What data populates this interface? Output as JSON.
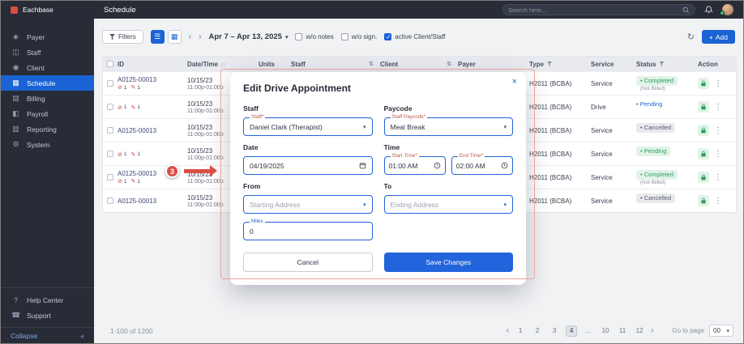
{
  "app": {
    "brand": "Eachbase",
    "title": "Schedule"
  },
  "topbar": {
    "search_placeholder": "Search here..."
  },
  "sidebar": {
    "items": [
      {
        "label": "Payer",
        "icon": "◈"
      },
      {
        "label": "Staff",
        "icon": "◫"
      },
      {
        "label": "Client",
        "icon": "◉"
      },
      {
        "label": "Schedule",
        "icon": "▦"
      },
      {
        "label": "Billing",
        "icon": "▤"
      },
      {
        "label": "Payroll",
        "icon": "◧"
      },
      {
        "label": "Reporting",
        "icon": "▥"
      },
      {
        "label": "System",
        "icon": "⚙"
      }
    ],
    "footer": [
      {
        "label": "Help Center",
        "icon": "?"
      },
      {
        "label": "Support",
        "icon": "☎"
      }
    ],
    "collapse": "Collapse",
    "collapse_icon": "«"
  },
  "toolbar": {
    "filters": "Filters",
    "date_range": "Apr 7 – Apr 13, 2025",
    "checkboxes": [
      {
        "label": "w/o notes",
        "checked": false
      },
      {
        "label": "w/o sign.",
        "checked": false
      },
      {
        "label": "active Client/Staff",
        "checked": true
      }
    ],
    "add": "Add",
    "add_plus": "+"
  },
  "table": {
    "columns": [
      {
        "label": "ID"
      },
      {
        "label": "Date/Time"
      },
      {
        "label": "Units"
      },
      {
        "label": "Staff"
      },
      {
        "label": "Client"
      },
      {
        "label": "Payer"
      },
      {
        "label": "Type"
      },
      {
        "label": "Service"
      },
      {
        "label": "Status"
      },
      {
        "label": "Action"
      }
    ],
    "rows": [
      {
        "id": "A0125-00013",
        "has_icons": true,
        "notes_count": "1",
        "sign_count": "1",
        "date": "10/15/23",
        "time": "11:00p-01:00p",
        "type": "H2011 (BCBA)",
        "service": "Service",
        "status": "Completed",
        "status_note": "(Not Billed)",
        "status_kind": "completed"
      },
      {
        "id": "",
        "has_icons": true,
        "notes_count": "1",
        "sign_count": "1",
        "date": "10/15/23",
        "time": "11:00p-01:00p",
        "type": "H2011 (BCBA)",
        "service": "Drive",
        "status": "Pending",
        "status_note": "",
        "status_kind": "pending-blue"
      },
      {
        "id": "A0125-00013",
        "has_icons": false,
        "notes_count": "",
        "sign_count": "",
        "date": "10/15/23",
        "time": "11:00p-01:00p",
        "type": "H2011 (BCBA)",
        "service": "Service",
        "status": "Cancelled",
        "status_note": "",
        "status_kind": "cancelled"
      },
      {
        "id": "",
        "has_icons": true,
        "notes_count": "1",
        "sign_count": "1",
        "date": "10/15/23",
        "time": "11:00p-01:00p",
        "type": "H2011 (BCBA)",
        "service": "Service",
        "status": "Pending",
        "status_note": "",
        "status_kind": "pending-green"
      },
      {
        "id": "A0125-00013",
        "has_icons": true,
        "notes_count": "1",
        "sign_count": "1",
        "date": "10/15/23",
        "time": "11:00p-01:00p",
        "type": "H2011 (BCBA)",
        "service": "Service",
        "status": "Completed",
        "status_note": "(Not Billed)",
        "status_kind": "completed"
      },
      {
        "id": "A0125-00013",
        "has_icons": false,
        "notes_count": "",
        "sign_count": "",
        "date": "10/15/23",
        "time": "11:00p-01:00p",
        "type": "H2011 (BCBA)",
        "service": "Service",
        "status": "Cancelled",
        "status_note": "",
        "status_kind": "cancelled"
      }
    ]
  },
  "pagination": {
    "range": "1-100 of 1200",
    "pages": [
      "1",
      "2",
      "3",
      "4",
      "…",
      "10",
      "11",
      "12"
    ],
    "active_index": 3,
    "goto_label": "Go to page",
    "goto_value": "00"
  },
  "modal": {
    "title": "Edit Drive Appointment",
    "sections": {
      "staff": "Staff",
      "paycode": "Paycode",
      "date": "Date",
      "time": "Time",
      "from": "From",
      "to": "To"
    },
    "fields": {
      "staff_label": "Staff*",
      "staff_value": "Daniel Clark (Therapist)",
      "paycode_label": "Staff Paycode*",
      "paycode_value": "Meal Break",
      "date_value": "04/19/2025",
      "start_label": "Start Time*",
      "start_value": "01:00 AM",
      "end_label": "End Time*",
      "end_value": "02:00 AM",
      "from_placeholder": "Starting Address",
      "to_placeholder": "Ending Address",
      "miles_label": "Miles",
      "miles_value": "0"
    },
    "cancel": "Cancel",
    "save": "Save Changes"
  },
  "annotation": {
    "step": "3"
  },
  "colors": {
    "accent": "#1a63d4",
    "green": "#2f9e5f",
    "red": "#d94f44"
  }
}
